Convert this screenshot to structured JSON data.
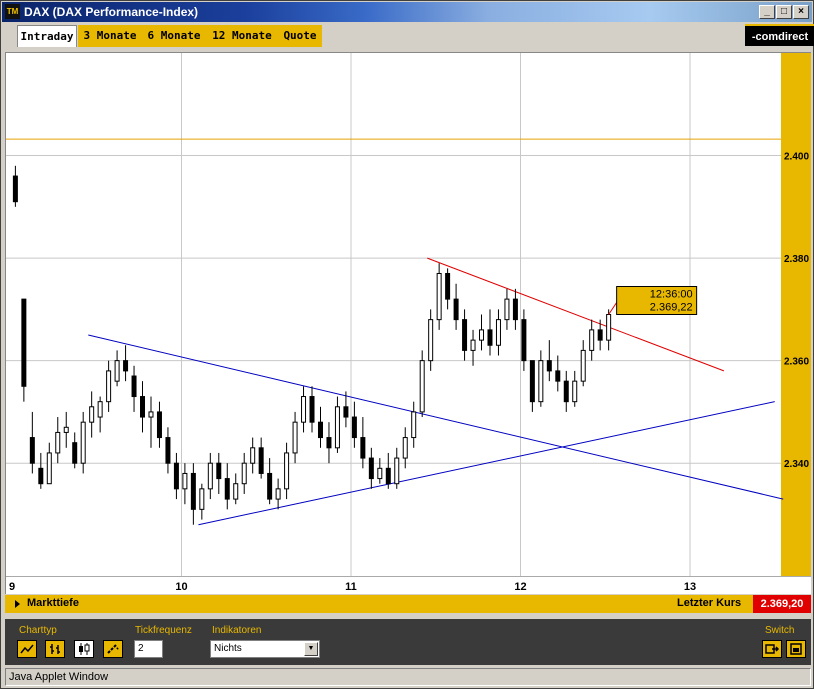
{
  "window": {
    "title": "DAX (DAX Performance-Index)",
    "app_icon": "TM",
    "minimize": "_",
    "maximize": "□",
    "close": "×"
  },
  "tabs": [
    {
      "label": "Intraday",
      "active": true
    },
    {
      "label": "3 Monate",
      "active": false
    },
    {
      "label": "6 Monate",
      "active": false
    },
    {
      "label": "12 Monate",
      "active": false
    },
    {
      "label": "Quote",
      "active": false
    }
  ],
  "logo": "-comdirect",
  "colors": {
    "accent": "#e8b800",
    "trend_blue": "#0000c0",
    "trend_red": "#e00000",
    "last_price_bg": "#e00000"
  },
  "chart_data": {
    "type": "candlestick",
    "x_ticks": [
      "9",
      "10",
      "11",
      "12",
      "13"
    ],
    "y_ticks": [
      "2.400",
      "2.380",
      "2.360",
      "2.340"
    ],
    "ylim": [
      2318,
      2420
    ],
    "xlim": [
      9.0,
      13.7
    ],
    "reference_line": 2403.2,
    "tooltip": {
      "time": "12:36:00",
      "value": "2.369,22"
    },
    "candles": [
      [
        9.02,
        2396,
        2398,
        2390,
        2391
      ],
      [
        9.07,
        2372,
        2372,
        2352,
        2355
      ],
      [
        9.12,
        2345,
        2350,
        2338,
        2340
      ],
      [
        9.17,
        2339,
        2342,
        2335,
        2336
      ],
      [
        9.22,
        2336,
        2344,
        2336,
        2342
      ],
      [
        9.27,
        2342,
        2349,
        2340,
        2346
      ],
      [
        9.32,
        2346,
        2350,
        2343,
        2347
      ],
      [
        9.37,
        2344,
        2346,
        2339,
        2340
      ],
      [
        9.42,
        2340,
        2350,
        2338,
        2348
      ],
      [
        9.47,
        2348,
        2354,
        2345,
        2351
      ],
      [
        9.52,
        2349,
        2353,
        2346,
        2352
      ],
      [
        9.57,
        2352,
        2360,
        2350,
        2358
      ],
      [
        9.62,
        2356,
        2362,
        2355,
        2360
      ],
      [
        9.67,
        2360,
        2363,
        2356,
        2358
      ],
      [
        9.72,
        2357,
        2359,
        2350,
        2353
      ],
      [
        9.77,
        2353,
        2356,
        2346,
        2349
      ],
      [
        9.82,
        2349,
        2353,
        2343,
        2350
      ],
      [
        9.87,
        2350,
        2352,
        2343,
        2345
      ],
      [
        9.92,
        2345,
        2347,
        2338,
        2340
      ],
      [
        9.97,
        2340,
        2342,
        2333,
        2335
      ],
      [
        10.02,
        2335,
        2340,
        2332,
        2338
      ],
      [
        10.07,
        2338,
        2340,
        2328,
        2331
      ],
      [
        10.12,
        2331,
        2336,
        2329,
        2335
      ],
      [
        10.17,
        2335,
        2342,
        2333,
        2340
      ],
      [
        10.22,
        2340,
        2342,
        2334,
        2337
      ],
      [
        10.27,
        2337,
        2340,
        2331,
        2333
      ],
      [
        10.32,
        2333,
        2338,
        2332,
        2336
      ],
      [
        10.37,
        2336,
        2342,
        2334,
        2340
      ],
      [
        10.42,
        2340,
        2345,
        2338,
        2343
      ],
      [
        10.47,
        2343,
        2345,
        2337,
        2338
      ],
      [
        10.52,
        2338,
        2341,
        2332,
        2333
      ],
      [
        10.57,
        2333,
        2337,
        2331,
        2335
      ],
      [
        10.62,
        2335,
        2344,
        2333,
        2342
      ],
      [
        10.67,
        2342,
        2350,
        2340,
        2348
      ],
      [
        10.72,
        2348,
        2355,
        2346,
        2353
      ],
      [
        10.77,
        2353,
        2355,
        2346,
        2348
      ],
      [
        10.82,
        2348,
        2351,
        2343,
        2345
      ],
      [
        10.87,
        2345,
        2348,
        2340,
        2343
      ],
      [
        10.92,
        2343,
        2353,
        2342,
        2351
      ],
      [
        10.97,
        2351,
        2354,
        2347,
        2349
      ],
      [
        11.02,
        2349,
        2352,
        2343,
        2345
      ],
      [
        11.07,
        2345,
        2349,
        2339,
        2341
      ],
      [
        11.12,
        2341,
        2343,
        2335,
        2337
      ],
      [
        11.17,
        2337,
        2341,
        2336,
        2339
      ],
      [
        11.22,
        2339,
        2342,
        2335,
        2336
      ],
      [
        11.27,
        2336,
        2343,
        2335,
        2341
      ],
      [
        11.32,
        2341,
        2347,
        2339,
        2345
      ],
      [
        11.37,
        2345,
        2352,
        2343,
        2350
      ],
      [
        11.42,
        2350,
        2362,
        2349,
        2360
      ],
      [
        11.47,
        2360,
        2370,
        2358,
        2368
      ],
      [
        11.52,
        2368,
        2379,
        2366,
        2377
      ],
      [
        11.57,
        2377,
        2378,
        2370,
        2372
      ],
      [
        11.62,
        2372,
        2375,
        2366,
        2368
      ],
      [
        11.67,
        2368,
        2370,
        2360,
        2362
      ],
      [
        11.72,
        2362,
        2366,
        2359,
        2364
      ],
      [
        11.77,
        2364,
        2369,
        2362,
        2366
      ],
      [
        11.82,
        2366,
        2370,
        2361,
        2363
      ],
      [
        11.87,
        2363,
        2370,
        2361,
        2368
      ],
      [
        11.92,
        2368,
        2374,
        2366,
        2372
      ],
      [
        11.97,
        2372,
        2374,
        2366,
        2368
      ],
      [
        12.02,
        2368,
        2370,
        2358,
        2360
      ],
      [
        12.07,
        2360,
        2360,
        2350,
        2352
      ],
      [
        12.12,
        2352,
        2362,
        2351,
        2360
      ],
      [
        12.17,
        2360,
        2364,
        2356,
        2358
      ],
      [
        12.22,
        2358,
        2361,
        2354,
        2356
      ],
      [
        12.27,
        2356,
        2358,
        2350,
        2352
      ],
      [
        12.32,
        2352,
        2358,
        2351,
        2356
      ],
      [
        12.37,
        2356,
        2364,
        2355,
        2362
      ],
      [
        12.42,
        2362,
        2368,
        2360,
        2366
      ],
      [
        12.47,
        2366,
        2368,
        2362,
        2364
      ],
      [
        12.52,
        2364,
        2370,
        2362,
        2369
      ]
    ],
    "trendlines": [
      {
        "color": "blue",
        "from": [
          9.45,
          2365
        ],
        "to": [
          13.55,
          2333
        ]
      },
      {
        "color": "blue",
        "from": [
          10.1,
          2328
        ],
        "to": [
          13.5,
          2352
        ]
      },
      {
        "color": "red",
        "from": [
          11.45,
          2380
        ],
        "to": [
          13.2,
          2358
        ]
      }
    ]
  },
  "status": {
    "markttiefe": "Markttiefe",
    "letzter_kurs_label": "Letzter Kurs",
    "letzter_kurs_value": "2.369,20"
  },
  "controls": {
    "charttyp_label": "Charttyp",
    "tickfrequenz_label": "Tickfrequenz",
    "tickfrequenz_value": "2",
    "indikatoren_label": "Indikatoren",
    "indikatoren_value": "Nichts",
    "switch_label": "Switch"
  },
  "applet_status": "Java Applet Window"
}
